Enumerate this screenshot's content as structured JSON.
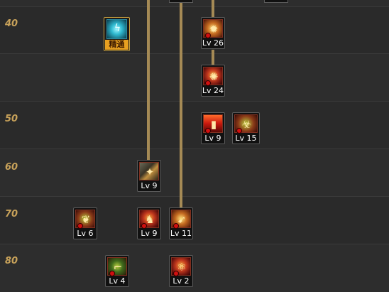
{
  "levels": [
    {
      "label": "40"
    },
    {
      "label": "50"
    },
    {
      "label": "60"
    },
    {
      "label": "70"
    },
    {
      "label": "80"
    }
  ],
  "skills": [
    {
      "id": "elite",
      "tag": "精通",
      "icon": "lightning-icon"
    },
    {
      "id": "s40a",
      "label": "Lv 26",
      "icon": "sunburst-icon"
    },
    {
      "id": "s40b",
      "label": "Lv 24",
      "icon": "vortex-icon"
    },
    {
      "id": "s50a",
      "label": "Lv 9",
      "icon": "flame-pillar-icon"
    },
    {
      "id": "s50b",
      "label": "Lv 15",
      "icon": "toxic-creature-icon"
    },
    {
      "id": "s60a",
      "label": "Lv 9",
      "icon": "rune-sparks-icon"
    },
    {
      "id": "s70a",
      "label": "Lv 6",
      "icon": "green-spirit-icon"
    },
    {
      "id": "s70b",
      "label": "Lv 9",
      "icon": "dark-warrior-icon"
    },
    {
      "id": "s70c",
      "label": "Lv 11",
      "icon": "missile-barrage-icon"
    },
    {
      "id": "s80a",
      "label": "Lv 4",
      "icon": "heavy-gun-icon"
    },
    {
      "id": "s80b",
      "label": "Lv 2",
      "icon": "orbit-blast-icon"
    }
  ],
  "colors": {
    "background": "#2c2c2c",
    "level_text": "#c8a25a",
    "connector": "#a58a55",
    "elite_tag": "#e8a020"
  }
}
